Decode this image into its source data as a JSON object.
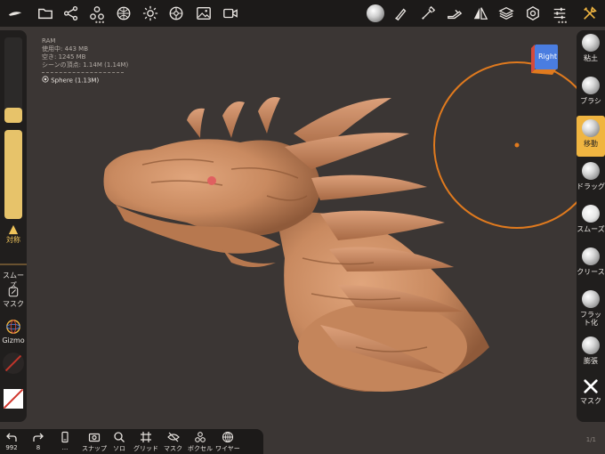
{
  "stats": {
    "ram": "RAM",
    "used": "使用中: 443 MB",
    "free": "空き: 1245 MB",
    "vertices": "シーンの頂点: 1.14M (1.14M)",
    "object": "Sphere (1.13M)"
  },
  "viewcube": {
    "face": "Right"
  },
  "left_panel": {
    "symmetry": "対称",
    "smooth": "スムーズ",
    "mask": "マスク",
    "gizmo": "Gizmo"
  },
  "tools": [
    {
      "label": "粘土"
    },
    {
      "label": "ブラシ"
    },
    {
      "label": "移動"
    },
    {
      "label": "ドラッグ"
    },
    {
      "label": "スムーズ"
    },
    {
      "label": "クリース"
    },
    {
      "label": "フラット化"
    },
    {
      "label": "膨張"
    },
    {
      "label": "マスク"
    }
  ],
  "active_tool": "移動",
  "bottom": {
    "undo_count": "992",
    "redo_count": "8",
    "more": "...",
    "snap": "スナップ",
    "solo": "ソロ",
    "grid": "グリッド",
    "mask": "マスク",
    "voxel": "ボクセル",
    "wire": "ワイヤー"
  },
  "page_number": "1/1",
  "colors": {
    "accent": "#f0b541",
    "background": "#3b3634",
    "model": "#c98a60",
    "ring": "#e07a1e"
  },
  "icons": [
    "nomad-logo-icon",
    "folder-icon",
    "scene-graph-icon",
    "topology-icon",
    "material-icon",
    "light-icon",
    "postprocess-icon",
    "background-image-icon",
    "camera-icon",
    "material-sphere-icon",
    "paint-icon",
    "stroke-icon",
    "tool-icon",
    "symmetry-icon",
    "layers-icon",
    "settings-icon",
    "sliders-icon",
    "tools-icon"
  ]
}
